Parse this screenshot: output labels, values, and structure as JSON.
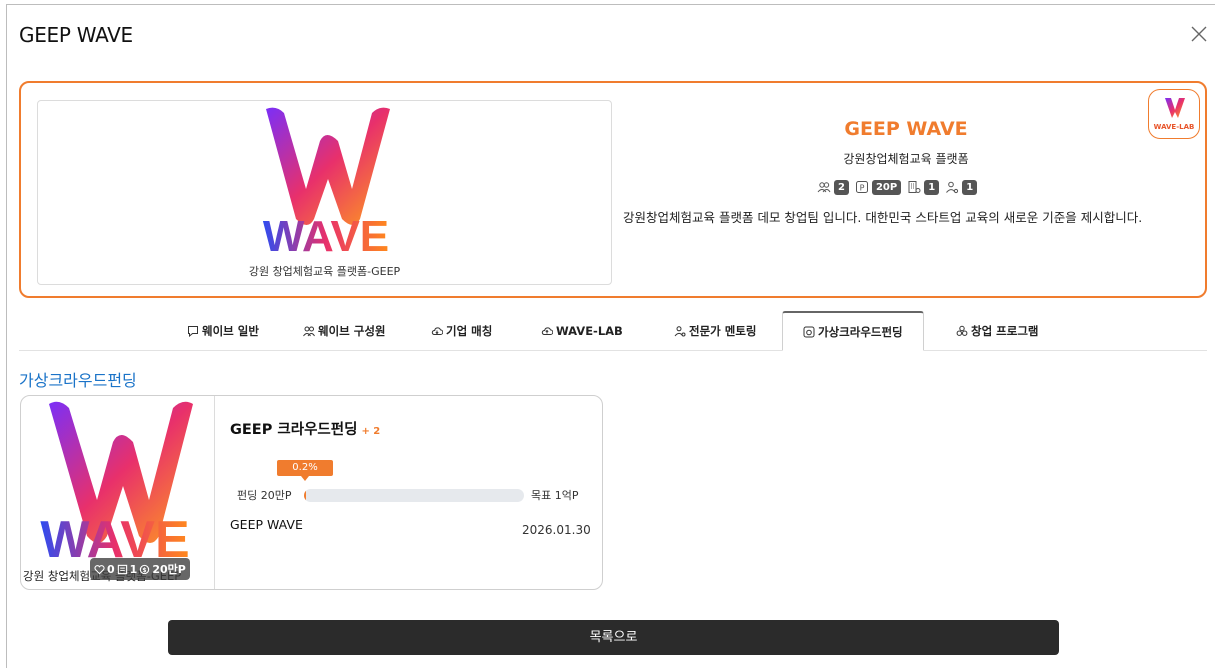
{
  "modal": {
    "title": "GEEP WAVE"
  },
  "team": {
    "logo_caption": "강원 창업체험교육 플랫폼-GEEP",
    "logo_word": "WAVE",
    "badge_text": "WAVE-LAB",
    "name": "GEEP WAVE",
    "subtitle": "강원창업체험교육 플랫폼",
    "stats": {
      "members": "2",
      "points": "20P",
      "companies": "1",
      "mentors": "1"
    },
    "description": "강원창업체험교육 플랫폼 데모 창업팀 입니다. 대한민국 스타트업 교육의 새로운 기준을 제시합니다."
  },
  "tabs": [
    {
      "label": "웨이브 일반",
      "icon": "chat-icon"
    },
    {
      "label": "웨이브 구성원",
      "icon": "members-icon"
    },
    {
      "label": "기업 매칭",
      "icon": "cloud-icon"
    },
    {
      "label": "WAVE-LAB",
      "icon": "cloud-icon"
    },
    {
      "label": "전문가 멘토링",
      "icon": "person-icon"
    },
    {
      "label": "가상크라우드펀딩",
      "icon": "funding-icon"
    },
    {
      "label": "창업 프로그램",
      "icon": "program-icon"
    }
  ],
  "section": {
    "title": "가상크라우드펀딩"
  },
  "funding": {
    "thumb_caption": "강원 창업체험교육 플랫폼-GEEP",
    "thumb_word": "WAVE",
    "likes": "0",
    "comments": "1",
    "points": "20만P",
    "title": "GEEP 크라우드펀딩",
    "plus": "+ 2",
    "percent_label": "0.2%",
    "percent": 0.2,
    "raised_label": "펀딩 20만P",
    "goal_label": "목표 1억P",
    "team": "GEEP WAVE",
    "date": "2026.01.30"
  },
  "footer": {
    "button_label": "목록으로"
  },
  "colors": {
    "accent": "#f07c2e",
    "link": "#1a73c8",
    "dark": "#2b2b2b"
  }
}
